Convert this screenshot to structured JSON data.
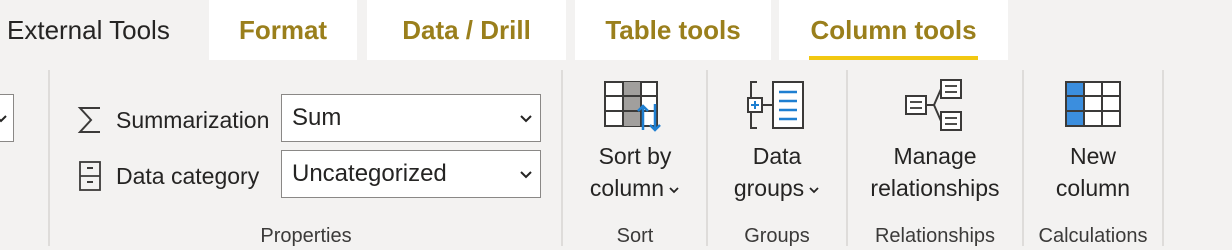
{
  "tabs": [
    {
      "label": "External Tools",
      "active": false
    },
    {
      "label": "Format",
      "active": false
    },
    {
      "label": "Data / Drill",
      "active": false
    },
    {
      "label": "Table tools",
      "active": false
    },
    {
      "label": "Column tools",
      "active": true
    }
  ],
  "properties": {
    "summarization_label": "Summarization",
    "summarization_value": "Sum",
    "data_category_label": "Data category",
    "data_category_value": "Uncategorized",
    "group_label": "Properties"
  },
  "sort": {
    "button_line1": "Sort by",
    "button_line2": "column",
    "group_label": "Sort"
  },
  "groups": {
    "button_line1": "Data",
    "button_line2": "groups",
    "group_label": "Groups"
  },
  "relationships": {
    "button_line1": "Manage",
    "button_line2": "relationships",
    "group_label": "Relationships"
  },
  "calculations": {
    "button_line1": "New",
    "button_line2": "column",
    "group_label": "Calculations"
  },
  "colors": {
    "accent_underline": "#f2c811",
    "tab_text": "#9a7f1c",
    "icon_blue": "#1e7fd1"
  }
}
